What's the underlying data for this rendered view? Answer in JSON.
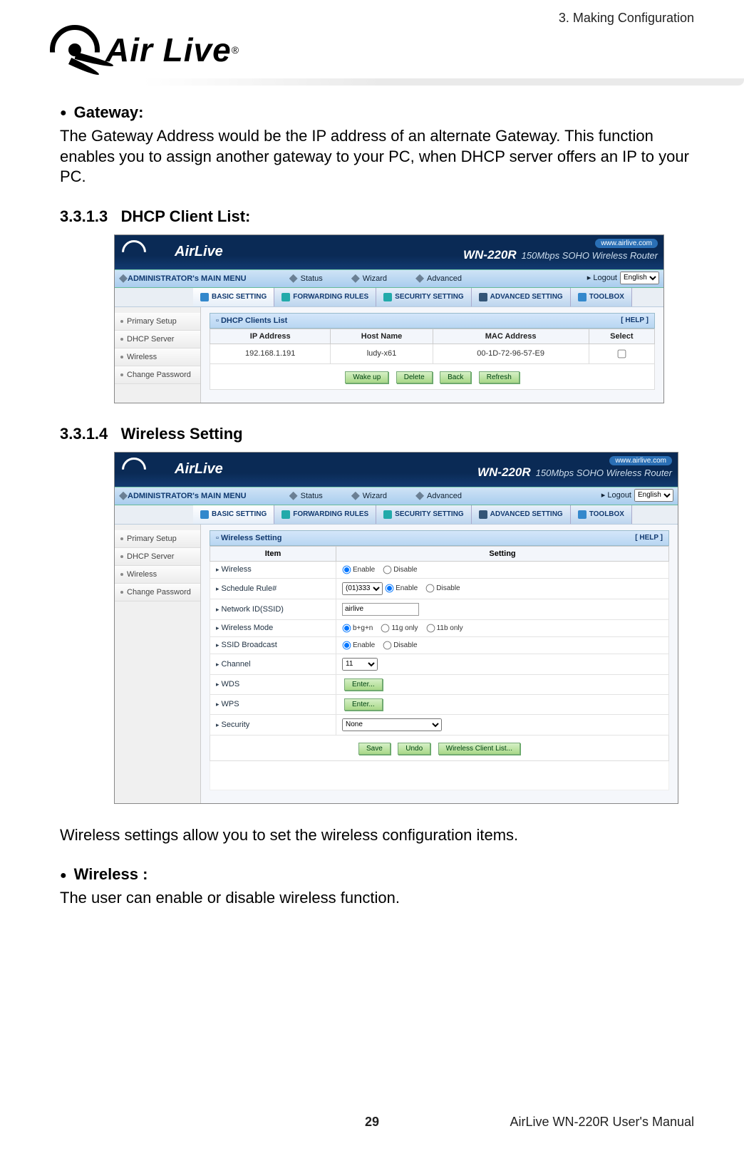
{
  "header": {
    "chapter": "3. Making Configuration"
  },
  "logo": {
    "brand": "Air Live",
    "reg": "®"
  },
  "gateway": {
    "title": "Gateway:",
    "text": "The Gateway Address would be the IP address of an alternate Gateway. This function enables you to assign another gateway to your PC, when DHCP server offers an IP to your PC."
  },
  "sec_dhcp": {
    "num": "3.3.1.3",
    "title": "DHCP Client List:"
  },
  "sec_wireless": {
    "num": "3.3.1.4",
    "title": "Wireless Setting"
  },
  "router_ui": {
    "brand": "AirLive",
    "url": "www.airlive.com",
    "model": "WN-220R",
    "model_desc": "150Mbps SOHO Wireless Router",
    "main_menu_label": "ADMINISTRATOR's MAIN MENU",
    "menu": {
      "status": "Status",
      "wizard": "Wizard",
      "advanced": "Advanced",
      "logout": "Logout"
    },
    "lang": "English",
    "tabs": {
      "basic": "BASIC SETTING",
      "forwarding": "FORWARDING RULES",
      "security": "SECURITY SETTING",
      "advanced": "ADVANCED SETTING",
      "toolbox": "TOOLBOX"
    },
    "sidebar": {
      "primary": "Primary Setup",
      "dhcp": "DHCP Server",
      "wireless": "Wireless",
      "changepw": "Change Password"
    },
    "help": "[ HELP ]"
  },
  "dhcp_panel": {
    "title": "DHCP Clients List",
    "cols": {
      "ip": "IP Address",
      "host": "Host Name",
      "mac": "MAC Address",
      "select": "Select"
    },
    "rows": [
      {
        "ip": "192.168.1.191",
        "host": "ludy-x61",
        "mac": "00-1D-72-96-57-E9"
      }
    ],
    "buttons": {
      "wakeup": "Wake up",
      "delete": "Delete",
      "back": "Back",
      "refresh": "Refresh"
    }
  },
  "wireless_panel": {
    "title": "Wireless Setting",
    "header": {
      "item": "Item",
      "setting": "Setting"
    },
    "rows": {
      "wireless": {
        "label": "Wireless",
        "enable": "Enable",
        "disable": "Disable"
      },
      "schedule": {
        "label": "Schedule Rule#",
        "selected": "(01)333",
        "enable": "Enable",
        "disable": "Disable"
      },
      "ssid": {
        "label": "Network ID(SSID)",
        "value": "airlive"
      },
      "mode": {
        "label": "Wireless Mode",
        "opt1": "b+g+n",
        "opt2": "11g only",
        "opt3": "11b only"
      },
      "bcast": {
        "label": "SSID Broadcast",
        "enable": "Enable",
        "disable": "Disable"
      },
      "channel": {
        "label": "Channel",
        "selected": "11"
      },
      "wds": {
        "label": "WDS",
        "btn": "Enter..."
      },
      "wps": {
        "label": "WPS",
        "btn": "Enter..."
      },
      "security": {
        "label": "Security",
        "selected": "None"
      }
    },
    "buttons": {
      "save": "Save",
      "undo": "Undo",
      "clientlist": "Wireless Client List..."
    }
  },
  "closing": {
    "intro": "Wireless settings allow you to set the wireless configuration items.",
    "wireless_head": "Wireless :",
    "wireless_text": "The user can enable or disable wireless function."
  },
  "footer": {
    "page": "29",
    "manual": "AirLive WN-220R User's Manual"
  }
}
